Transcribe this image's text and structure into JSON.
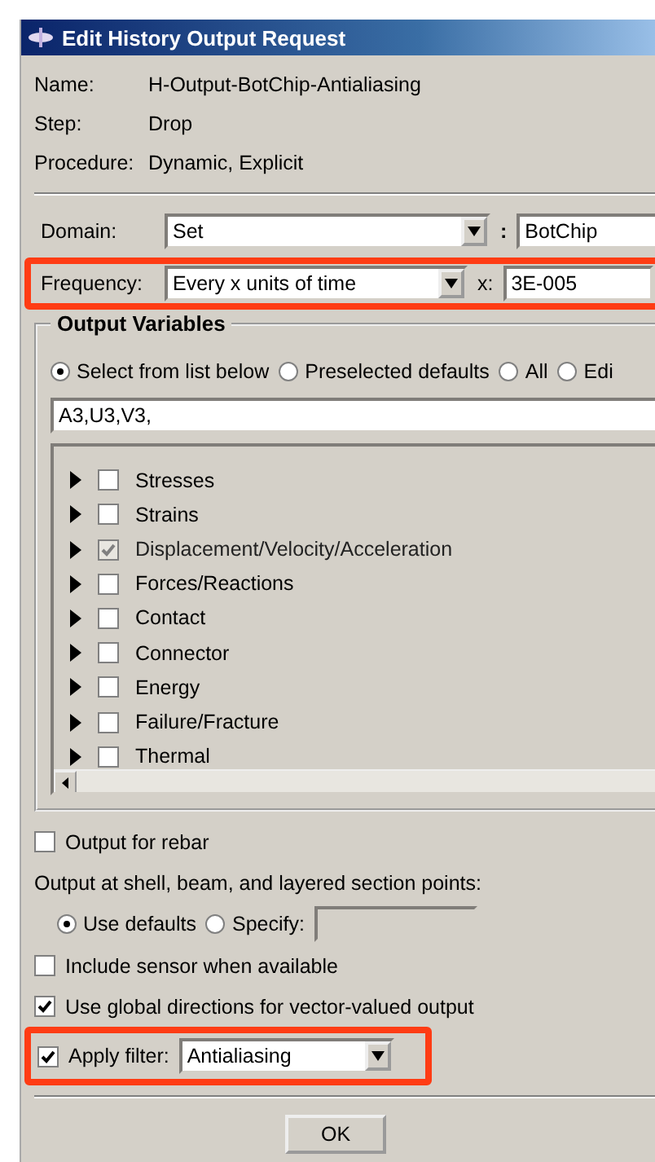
{
  "window": {
    "title": "Edit History Output Request"
  },
  "info": [
    {
      "label": "Name:",
      "value": "H-Output-BotChip-Antialiasing"
    },
    {
      "label": "Step:",
      "value": "Drop"
    },
    {
      "label": "Procedure:",
      "value": "Dynamic, Explicit"
    }
  ],
  "domain": {
    "label": "Domain:",
    "value": "Set",
    "separator": ":",
    "target": "BotChip"
  },
  "frequency": {
    "label": "Frequency:",
    "value": "Every x units of time",
    "x_label": "x:",
    "x_value": "3E-005",
    "highlighted": true
  },
  "output_variables": {
    "title": "Output Variables",
    "modes": [
      {
        "label": "Select from list below",
        "selected": true
      },
      {
        "label": "Preselected defaults",
        "selected": false
      },
      {
        "label": "All",
        "selected": false
      },
      {
        "label": "Edi",
        "selected": false
      }
    ],
    "list_text": "A3,U3,V3,",
    "tree": [
      {
        "label": "Stresses",
        "checked": false,
        "disabled": false
      },
      {
        "label": "Strains",
        "checked": false,
        "disabled": false
      },
      {
        "label": "Displacement/Velocity/Acceleration",
        "checked": true,
        "disabled": true
      },
      {
        "label": "Forces/Reactions",
        "checked": false,
        "disabled": false
      },
      {
        "label": "Contact",
        "checked": false,
        "disabled": false
      },
      {
        "label": "Connector",
        "checked": false,
        "disabled": false
      },
      {
        "label": "Energy",
        "checked": false,
        "disabled": false
      },
      {
        "label": "Failure/Fracture",
        "checked": false,
        "disabled": false
      },
      {
        "label": "Thermal",
        "checked": false,
        "disabled": false
      }
    ]
  },
  "rebar": {
    "label": "Output for rebar",
    "checked": false
  },
  "section_points": {
    "label": "Output at shell, beam, and layered section points:",
    "options": [
      {
        "label": "Use defaults",
        "selected": true
      },
      {
        "label": "Specify:",
        "selected": false
      }
    ]
  },
  "sensor": {
    "label": "Include sensor when available",
    "checked": false
  },
  "global_directions": {
    "label": "Use global directions for vector-valued output",
    "checked": true
  },
  "filter": {
    "label": "Apply filter:",
    "checked": true,
    "value": "Antialiasing",
    "highlighted": true
  },
  "buttons": [
    "OK"
  ]
}
